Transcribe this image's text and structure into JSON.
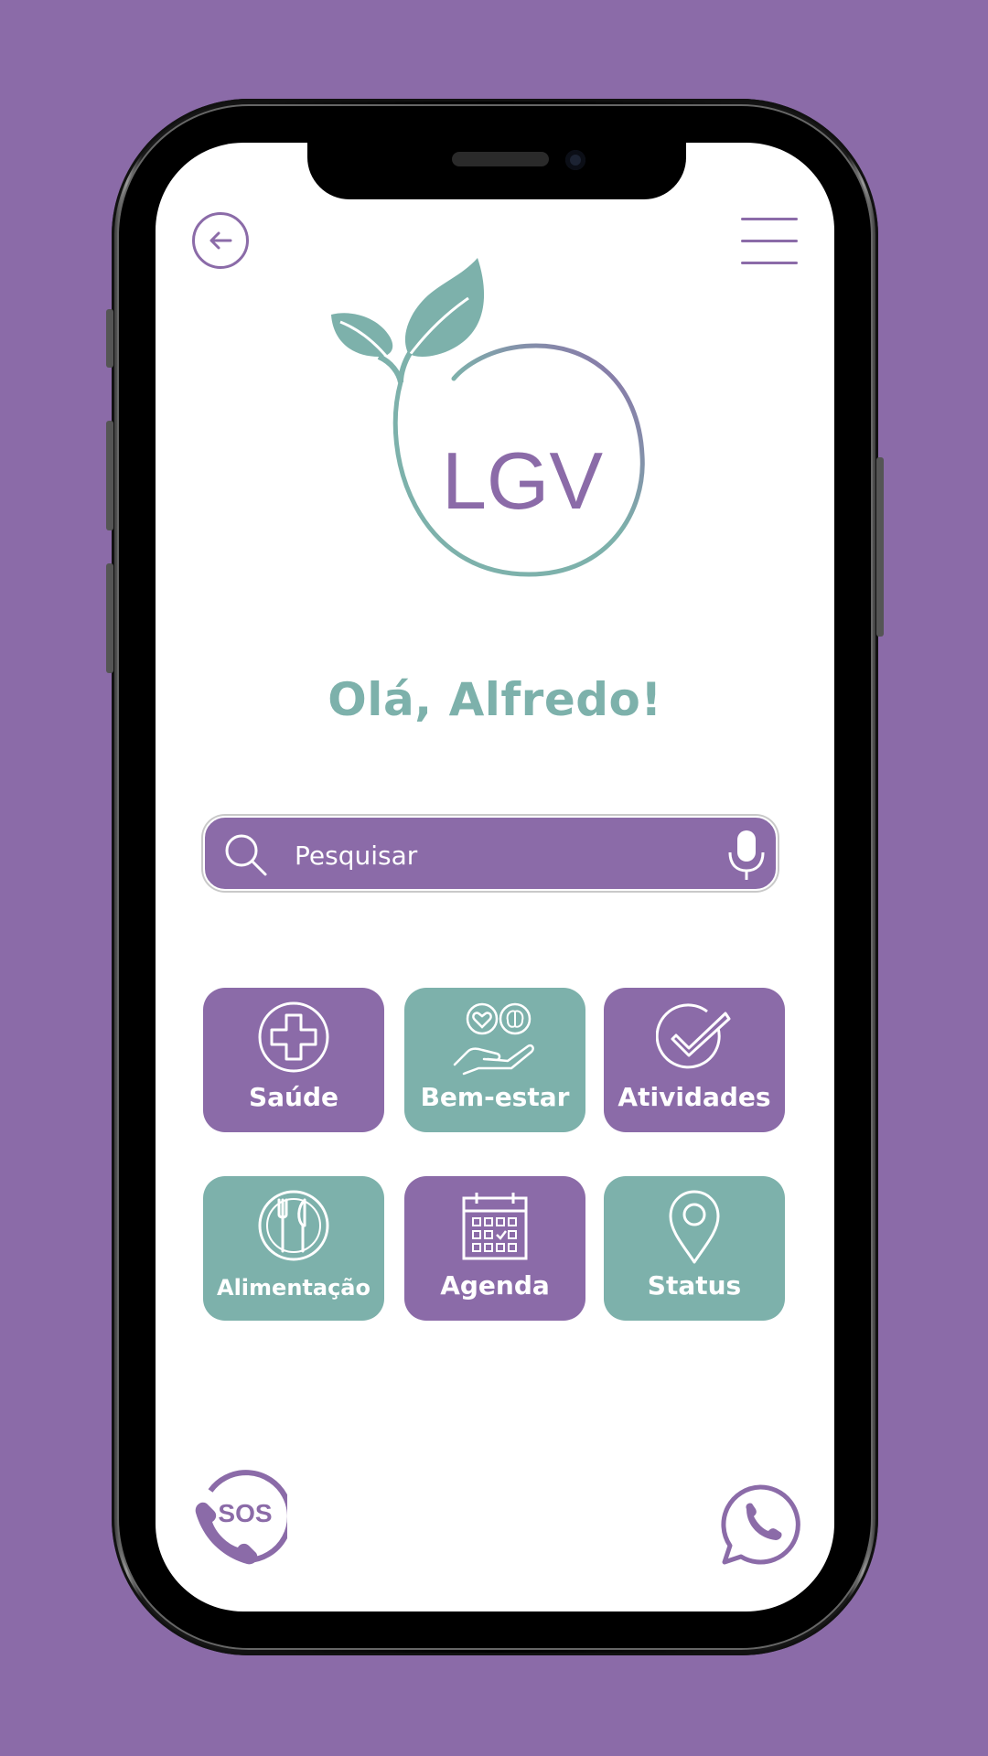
{
  "app": {
    "logo_text": "LGV",
    "greeting": "Olá, Alfredo!"
  },
  "header": {
    "back_icon": "arrow-left-circle-icon",
    "menu_icon": "hamburger-menu-icon"
  },
  "search": {
    "placeholder": "Pesquisar",
    "value": "",
    "left_icon": "search-icon",
    "right_icon": "microphone-icon"
  },
  "tiles": [
    {
      "label": "Saúde",
      "icon": "medical-cross-icon",
      "color": "#8b6ba8"
    },
    {
      "label": "Bem-estar",
      "icon": "hand-heart-brain-icon",
      "color": "#7db1ab"
    },
    {
      "label": "Atividades",
      "icon": "check-circle-icon",
      "color": "#8b6ba8"
    },
    {
      "label": "Alimentação",
      "icon": "plate-cutlery-icon",
      "color": "#7db1ab"
    },
    {
      "label": "Agenda",
      "icon": "calendar-icon",
      "color": "#8b6ba8"
    },
    {
      "label": "Status",
      "icon": "location-pin-icon",
      "color": "#7db1ab"
    }
  ],
  "bottom": {
    "sos_label": "SOS",
    "sos_icon": "sos-phone-icon",
    "whatsapp_icon": "whatsapp-phone-icon"
  },
  "colors": {
    "background": "#8b6ba8",
    "primary_purple": "#8b6ba8",
    "primary_teal": "#7db1ab",
    "screen": "#ffffff"
  }
}
